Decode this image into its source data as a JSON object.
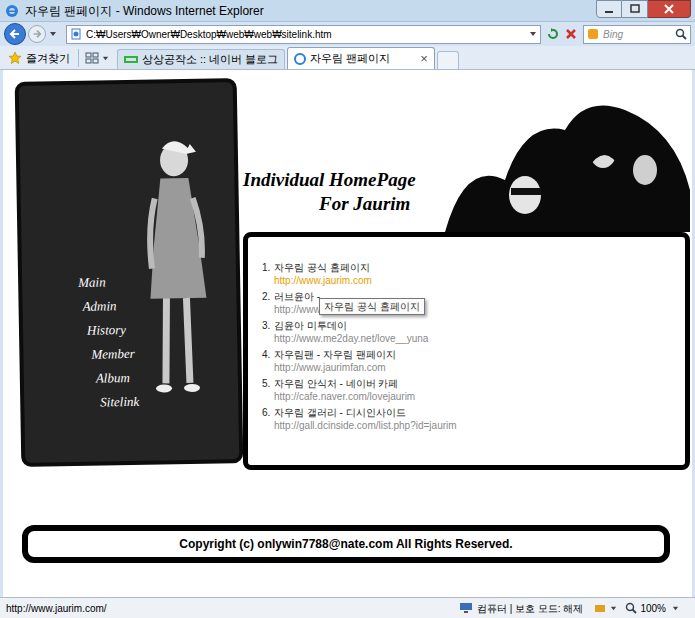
{
  "window": {
    "title": "자우림 팬페이지 - Windows Internet Explorer"
  },
  "address": "C:₩Users₩Owner₩Desktop₩web₩web₩sitelink.htm",
  "search": {
    "placeholder": "Bing"
  },
  "favorites": {
    "label": "즐겨찾기"
  },
  "tabs": [
    {
      "label": "상상공작소 :: 네이버 블로그",
      "selected": false
    },
    {
      "label": "자우림 팬페이지",
      "selected": true
    }
  ],
  "tab_close": "×",
  "page": {
    "menu": [
      "Main",
      "Admin",
      "History",
      "Member",
      "Album",
      "Sitelink"
    ],
    "heading": [
      "Individual HomePage",
      "For Jaurim"
    ],
    "links": [
      {
        "number": "1.",
        "title": "자우림 공식 홈페이지",
        "url": "http://www.jaurim.com",
        "hovered": true
      },
      {
        "number": "2.",
        "title": "러브윤아 -",
        "url": "http://www.loveyuna.com",
        "hovered": false
      },
      {
        "number": "3.",
        "title": "김윤아 미투데이",
        "url": "http://www.me2day.net/love__yuna",
        "hovered": false
      },
      {
        "number": "4.",
        "title": "자우림팬 - 자우림 팬페이지",
        "url": "http://www.jaurimfan.com",
        "hovered": false
      },
      {
        "number": "5.",
        "title": "자우림 안식처 - 네이버 카페",
        "url": "http://cafe.naver.com/lovejaurim",
        "hovered": false
      },
      {
        "number": "6.",
        "title": "자우림 갤러리 - 디시인사이드",
        "url": "http://gall.dcinside.com/list.php?id=jaurim",
        "hovered": false
      }
    ],
    "tooltip": "자우림 공식 홈페이지",
    "footer": "Copyright (c) onlywin7788@nate.com All Rights Reserved."
  },
  "status_bar": {
    "url": "http://www.jaurim.com/",
    "zone": "컴퓨터 | 보호 모드: 해제",
    "zoom": "100%"
  }
}
